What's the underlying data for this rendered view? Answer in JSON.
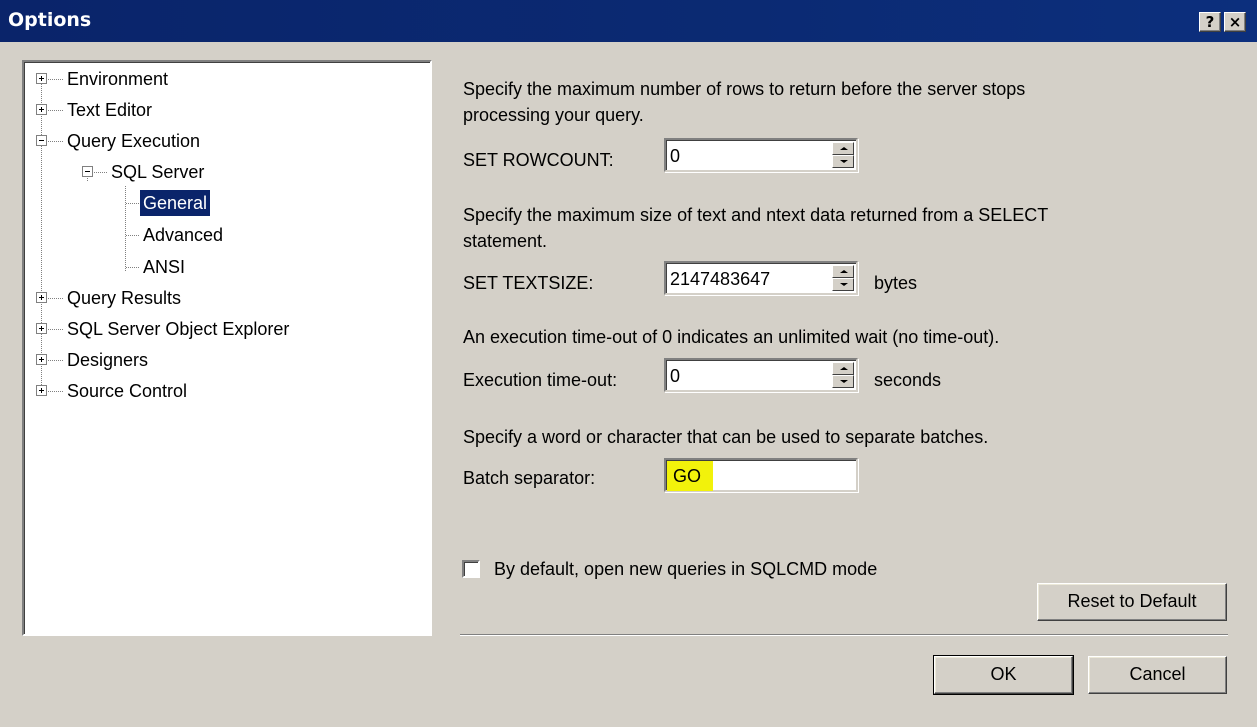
{
  "dialog": {
    "title": "Options",
    "help_button": "?",
    "close_button": "×"
  },
  "tree": {
    "items": [
      {
        "label": "Environment",
        "expander": "+"
      },
      {
        "label": "Text Editor",
        "expander": "+"
      },
      {
        "label": "Query Execution",
        "expander": "-"
      },
      {
        "label": "SQL Server",
        "expander": "-"
      },
      {
        "label": "General",
        "selected": true
      },
      {
        "label": "Advanced"
      },
      {
        "label": "ANSI"
      },
      {
        "label": "Query Results",
        "expander": "+"
      },
      {
        "label": "SQL Server Object Explorer",
        "expander": "+"
      },
      {
        "label": "Designers",
        "expander": "+"
      },
      {
        "label": "Source Control",
        "expander": "+"
      }
    ]
  },
  "settings": {
    "rowcount": {
      "description_line1": "Specify the maximum number of rows to return before the server stops",
      "description_line2": "processing your query.",
      "label": "SET ROWCOUNT:",
      "value": "0"
    },
    "textsize": {
      "description_line1": "Specify the maximum size of text and ntext data returned from a SELECT",
      "description_line2": "statement.",
      "label": "SET TEXTSIZE:",
      "value": "2147483647",
      "unit": "bytes"
    },
    "timeout": {
      "description": "An execution time-out of 0 indicates an unlimited wait (no time-out).",
      "label": "Execution time-out:",
      "value": "0",
      "unit": "seconds"
    },
    "batch": {
      "description": "Specify a word or character that can be used to separate batches.",
      "label": "Batch separator:",
      "value": "GO",
      "highlight_color": "#f2f20b"
    },
    "sqlcmd": {
      "label": "By default, open new queries in SQLCMD mode",
      "checked": false
    }
  },
  "buttons": {
    "reset": "Reset to Default",
    "ok": "OK",
    "cancel": "Cancel"
  },
  "colors": {
    "titlebar": "#0a246a",
    "face": "#d4d0c8",
    "selection": "#0a246a"
  }
}
